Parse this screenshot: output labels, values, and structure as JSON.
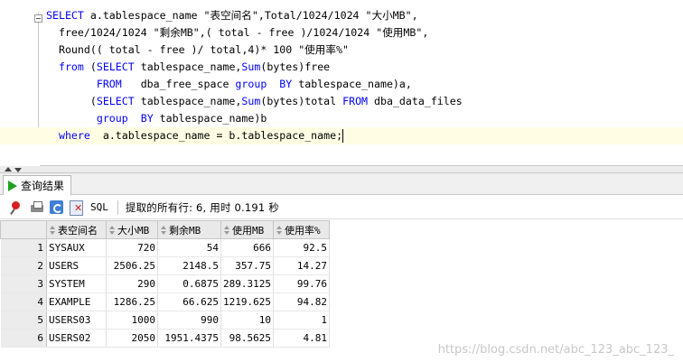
{
  "editor": {
    "lines": [
      [
        [
          "kw",
          "SELECT"
        ],
        [
          "t",
          " a.tablespace_name \"表空间名\",Total/1024/1024 \"大小MB\","
        ]
      ],
      [
        [
          "t",
          "  free/1024/1024 \"剩余MB\",( total - free )/1024/1024 \"使用MB\","
        ]
      ],
      [
        [
          "t",
          "  Round(( total - free )/ total,4)* 100 \"使用率%\""
        ]
      ],
      [
        [
          "t",
          "  "
        ],
        [
          "kw",
          "from"
        ],
        [
          "t",
          " ("
        ],
        [
          "kw",
          "SELECT"
        ],
        [
          "t",
          " tablespace_name,"
        ],
        [
          "fn",
          "Sum"
        ],
        [
          "t",
          "(bytes)free"
        ]
      ],
      [
        [
          "t",
          "        "
        ],
        [
          "kw",
          "FROM"
        ],
        [
          "t",
          "   dba_free_space "
        ],
        [
          "kw",
          "group"
        ],
        [
          "t",
          "  "
        ],
        [
          "kw",
          "BY"
        ],
        [
          "t",
          " tablespace_name)a,"
        ]
      ],
      [
        [
          "t",
          "       ("
        ],
        [
          "kw",
          "SELECT"
        ],
        [
          "t",
          " tablespace_name,"
        ],
        [
          "fn",
          "Sum"
        ],
        [
          "t",
          "(bytes)total "
        ],
        [
          "kw",
          "FROM"
        ],
        [
          "t",
          " dba_data_files"
        ]
      ],
      [
        [
          "t",
          "        "
        ],
        [
          "kw",
          "group"
        ],
        [
          "t",
          "  "
        ],
        [
          "kw",
          "BY"
        ],
        [
          "t",
          " tablespace_name)b"
        ]
      ],
      [
        [
          "t",
          "  "
        ],
        [
          "kw",
          "where"
        ],
        [
          "t",
          "  a.tablespace_name = b.tablespace_name;"
        ]
      ]
    ]
  },
  "results_tab": {
    "label": "查询结果"
  },
  "toolbar": {
    "sql_label": "SQL",
    "status": "提取的所有行: 6, 用时 0.191 秒"
  },
  "grid": {
    "columns": [
      "表空间名",
      "大小MB",
      "剩余MB",
      "使用MB",
      "使用率%"
    ],
    "rows": [
      [
        "1",
        "SYSAUX",
        "720",
        "54",
        "666",
        "92.5"
      ],
      [
        "2",
        "USERS",
        "2506.25",
        "2148.5",
        "357.75",
        "14.27"
      ],
      [
        "3",
        "SYSTEM",
        "290",
        "0.6875",
        "289.3125",
        "99.76"
      ],
      [
        "4",
        "EXAMPLE",
        "1286.25",
        "66.625",
        "1219.625",
        "94.82"
      ],
      [
        "5",
        "USERS03",
        "1000",
        "990",
        "10",
        "1"
      ],
      [
        "6",
        "USERS02",
        "2050",
        "1951.4375",
        "98.5625",
        "4.81"
      ]
    ]
  },
  "watermark": "https://blog.csdn.net/abc_123_abc_123_",
  "colors": {
    "keyword": "#0000ff",
    "run_icon": "#1fa01f",
    "current_line": "#fffde4"
  }
}
